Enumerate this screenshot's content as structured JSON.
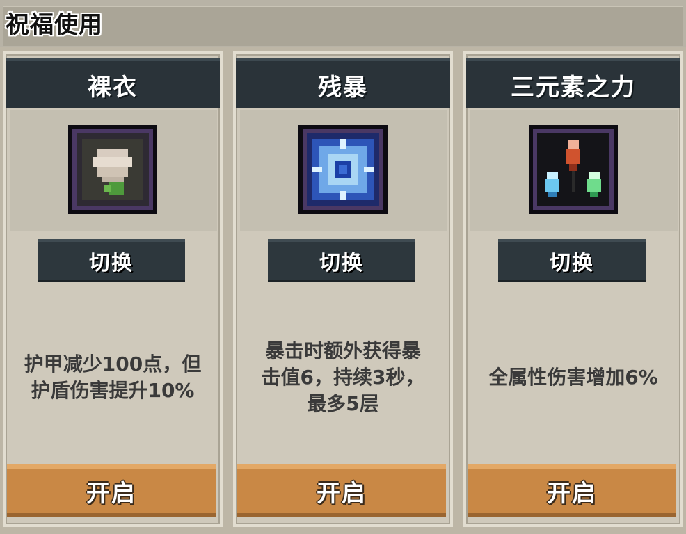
{
  "header": {
    "title": "祝福使用"
  },
  "cards": [
    {
      "name": "裸衣",
      "icon": "robe-icon",
      "switch_label": "切换",
      "description": "护甲减少100点，但\n护盾伤害提升10%",
      "open_label": "开启"
    },
    {
      "name": "残暴",
      "icon": "frost-burst-icon",
      "switch_label": "切换",
      "description": "暴击时额外获得暴\n击值6，持续3秒，\n最多5层",
      "open_label": "开启"
    },
    {
      "name": "三元素之力",
      "icon": "three-elements-icon",
      "switch_label": "切换",
      "description": "全属性伤害增加6%",
      "open_label": "开启"
    }
  ],
  "colors": {
    "header_bar": "#2a3339",
    "switch_button": "#2d373d",
    "open_button": "#c98845",
    "card_bg": "#cfc9bb"
  }
}
